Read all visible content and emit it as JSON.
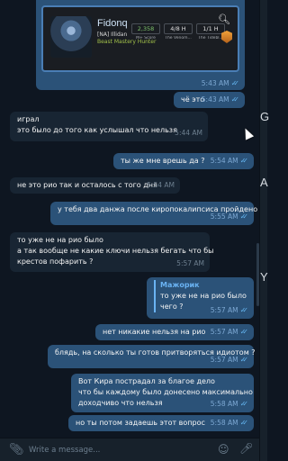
{
  "card": {
    "name": "Fidonq",
    "guild": "[NA] Illidan",
    "spec": "Beast Mastery Hunter",
    "stats": [
      {
        "value": "2,358",
        "label": "M+ Score"
      },
      {
        "value": "4/8 H",
        "label": "The Venom..."
      },
      {
        "value": "1/1 H",
        "label": "The Tidebl..."
      }
    ],
    "time": "5:43 AM"
  },
  "messages": [
    {
      "dir": "out",
      "lines": [
        "чё это"
      ],
      "time": "5:43 AM",
      "read": true
    },
    {
      "dir": "in",
      "lines": [
        "играл",
        "это было до того как услышал что нельзя"
      ],
      "time": "5:44 AM"
    },
    {
      "dir": "out",
      "lines": [
        "ты же мне врешь да ?"
      ],
      "time": "5:54 AM",
      "read": true
    },
    {
      "dir": "in",
      "lines": [
        "не это рио так и осталось с того дня"
      ],
      "time": "5:54 AM"
    },
    {
      "dir": "out",
      "lines": [
        "у тебя два данжа после киропокалипсиса пройдено"
      ],
      "time": "5:55 AM",
      "read": true
    },
    {
      "dir": "in",
      "lines": [
        "то уже не на рио было",
        "а так вообще не какие ключи нельзя бегать что бы",
        "крестов пофарить ?"
      ],
      "time": "5:57 AM"
    },
    {
      "dir": "out",
      "reply": {
        "name": "Мажорик",
        "text": "то уже не на рио было"
      },
      "lines": [
        "чего ?"
      ],
      "time": "5:57 AM",
      "read": true
    },
    {
      "dir": "out",
      "lines": [
        "нет никакие нельзя на рио"
      ],
      "time": "5:57 AM",
      "read": true
    },
    {
      "dir": "out",
      "lines": [
        "блядь, на сколько ты готов притворяться идиотом ?"
      ],
      "time": "5:57 AM",
      "read": true
    },
    {
      "dir": "out",
      "lines": [
        "Вот Кира пострадал за благое дело",
        "что бы каждому было донесено максимально",
        "доходчиво что нельзя"
      ],
      "time": "5:58 AM",
      "read": true
    },
    {
      "dir": "out",
      "lines": [
        "но ты потом задаешь этот вопрос"
      ],
      "time": "5:58 AM",
      "read": true
    }
  ],
  "composer": {
    "placeholder": "Write a message..."
  },
  "edge_fragments": [
    "G",
    "A",
    "Y"
  ],
  "colors": {
    "outgoing": "#2b5278",
    "incoming": "#182533",
    "background": "#0e1621",
    "accent": "#64b5ef"
  }
}
